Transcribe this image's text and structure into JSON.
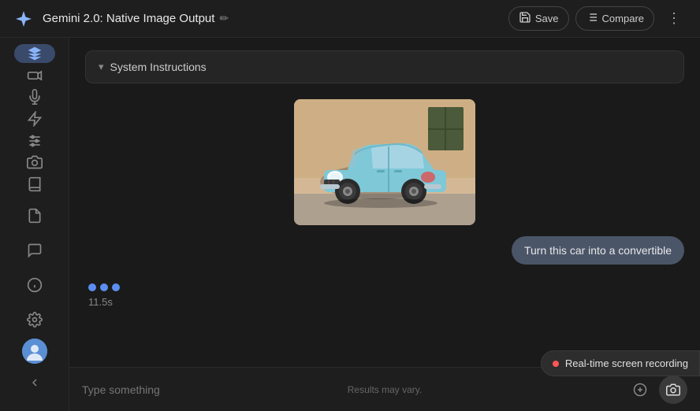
{
  "topbar": {
    "title": "Gemini 2.0: Native Image Output",
    "save_label": "Save",
    "compare_label": "Compare"
  },
  "system_instructions": {
    "label": "System Instructions"
  },
  "chat": {
    "message": "Turn this car into a convertible",
    "loading_time": "11.5s",
    "input_placeholder": "Type something",
    "footer_text": "Results may vary."
  },
  "recording_badge": {
    "label": "Real-time screen recording"
  },
  "sidebar": {
    "items": [
      {
        "icon": "⬡",
        "label": "home",
        "active": true
      },
      {
        "icon": "🎬",
        "label": "video"
      },
      {
        "icon": "🎤",
        "label": "mic"
      },
      {
        "icon": "⚡",
        "label": "lightning"
      },
      {
        "icon": "≡",
        "label": "settings-sliders"
      },
      {
        "icon": "🗓",
        "label": "calendar"
      },
      {
        "icon": "📖",
        "label": "book"
      },
      {
        "icon": "📄",
        "label": "document"
      },
      {
        "icon": "💬",
        "label": "chat"
      }
    ],
    "bottom": [
      {
        "icon": "ℹ",
        "label": "info"
      },
      {
        "icon": "⚙",
        "label": "gear"
      }
    ]
  },
  "icons": {
    "logo": "✦",
    "edit": "✏",
    "save": "💾",
    "compare": "⟨⟩",
    "more": "⋮",
    "chevron_down": "▾",
    "add": "+",
    "camera": "📷"
  }
}
